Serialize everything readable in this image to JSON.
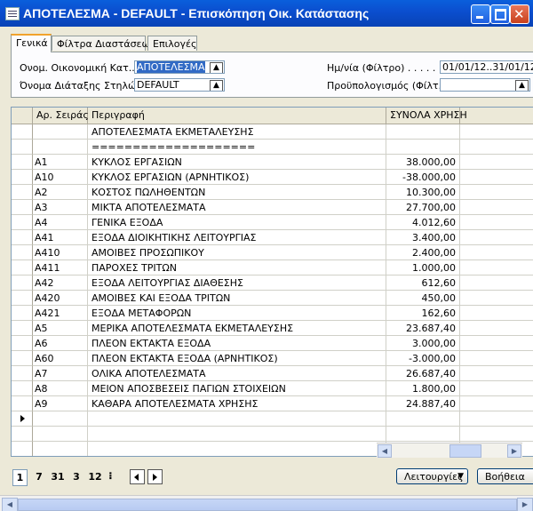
{
  "window": {
    "title": "ΑΠΟΤΕΛΕΣΜΑ - DEFAULT - Επισκόπηση Οικ. Κατάστασης",
    "icon": "report-window-icon"
  },
  "tabs": [
    {
      "label": "Γενικά"
    },
    {
      "label": "Φίλτρα Διαστάσεων"
    },
    {
      "label": "Επιλογές"
    }
  ],
  "form": {
    "financial_name_label": "Ονομ. Οικονομική Κατ...",
    "financial_name_value": "ΑΠΟΤΕΛΕΣΜΑ",
    "column_layout_label": "Όνομα Διάταξης Στηλών.",
    "column_layout_value": "DEFAULT",
    "date_filter_label": "Ημ/νία (Φίλτρο) . . . . .",
    "date_filter_value": "01/01/12..31/01/12",
    "budget_filter_label": "Προϋπολογισμός (Φίλτ...",
    "budget_filter_value": ""
  },
  "table": {
    "headers": {
      "code": "Αρ. Σειράς",
      "desc": "Περιγραφή",
      "total": "ΣΥΝΟΛΑ ΧΡΗΣΗ"
    },
    "rows": [
      {
        "code": "",
        "desc": "ΑΠΟΤΕΛΕΣΜΑΤΑ ΕΚΜΕΤΑΛΕΥΣΗΣ",
        "total": ""
      },
      {
        "code": "",
        "desc": "====================",
        "total": ""
      },
      {
        "code": "A1",
        "desc": "ΚΥΚΛΟΣ ΕΡΓΑΣΙΩΝ",
        "total": "38.000,00"
      },
      {
        "code": "A10",
        "desc": "ΚΥΚΛΟΣ ΕΡΓΑΣΙΩΝ (ΑΡΝΗΤΙΚΟΣ)",
        "total": "-38.000,00"
      },
      {
        "code": "A2",
        "desc": "ΚΟΣΤΟΣ ΠΩΛΗΘΕΝΤΩΝ",
        "total": "10.300,00"
      },
      {
        "code": "A3",
        "desc": "ΜΙΚΤΑ ΑΠΟΤΕΛΕΣΜΑΤΑ",
        "total": "27.700,00"
      },
      {
        "code": "A4",
        "desc": "ΓΕΝΙΚΑ ΕΞΟΔΑ",
        "total": "4.012,60"
      },
      {
        "code": "A41",
        "desc": "ΕΞΟΔΑ ΔΙΟΙΚΗΤΙΚΗΣ ΛΕΙΤΟΥΡΓΙΑΣ",
        "total": "3.400,00"
      },
      {
        "code": "A410",
        "desc": "ΑΜΟΙΒΕΣ ΠΡΟΣΩΠΙΚΟΥ",
        "total": "2.400,00"
      },
      {
        "code": "A411",
        "desc": "ΠΑΡΟΧΕΣ ΤΡΙΤΩΝ",
        "total": "1.000,00"
      },
      {
        "code": "A42",
        "desc": "ΕΞΟΔΑ ΛΕΙΤΟΥΡΓΙΑΣ ΔΙΑΘΕΣΗΣ",
        "total": "612,60"
      },
      {
        "code": "A420",
        "desc": "ΑΜΟΙΒΕΣ ΚΑΙ ΕΞΟΔΑ ΤΡΙΤΩΝ",
        "total": "450,00"
      },
      {
        "code": "A421",
        "desc": "ΕΞΟΔΑ ΜΕΤΑΦΟΡΩΝ",
        "total": "162,60"
      },
      {
        "code": "A5",
        "desc": "ΜΕΡΙΚΑ ΑΠΟΤΕΛΕΣΜΑΤΑ ΕΚΜΕΤΑΛΕΥΣΗΣ",
        "total": "23.687,40"
      },
      {
        "code": "A6",
        "desc": "ΠΛΕΟΝ ΕΚΤΑΚΤΑ ΕΞΟΔΑ",
        "total": "3.000,00"
      },
      {
        "code": "A60",
        "desc": "ΠΛΕΟΝ ΕΚΤΑΚΤΑ ΕΞΟΔΑ (ΑΡΝΗΤΙΚΟΣ)",
        "total": "-3.000,00"
      },
      {
        "code": "A7",
        "desc": "ΟΛΙΚΑ ΑΠΟΤΕΛΕΣΜΑΤΑ",
        "total": "26.687,40"
      },
      {
        "code": "A8",
        "desc": "ΜΕΙΟΝ ΑΠΟΣΒΕΣΕΙΣ ΠΑΓΙΩΝ ΣΤΟΙΧΕΙΩΝ",
        "total": "1.800,00"
      },
      {
        "code": "A9",
        "desc": "ΚΑΘΑΡΑ ΑΠΟΤΕΛΕΣΜΑΤΑ ΧΡΗΣΗΣ",
        "total": "24.887,40"
      }
    ],
    "current_row_index": 19
  },
  "pager": {
    "items": [
      "1",
      "7",
      "31",
      "3",
      "12"
    ],
    "overflow_glyph": "⠇"
  },
  "buttons": {
    "functions": "Λειτουργίες",
    "help": "Βοήθεια"
  }
}
